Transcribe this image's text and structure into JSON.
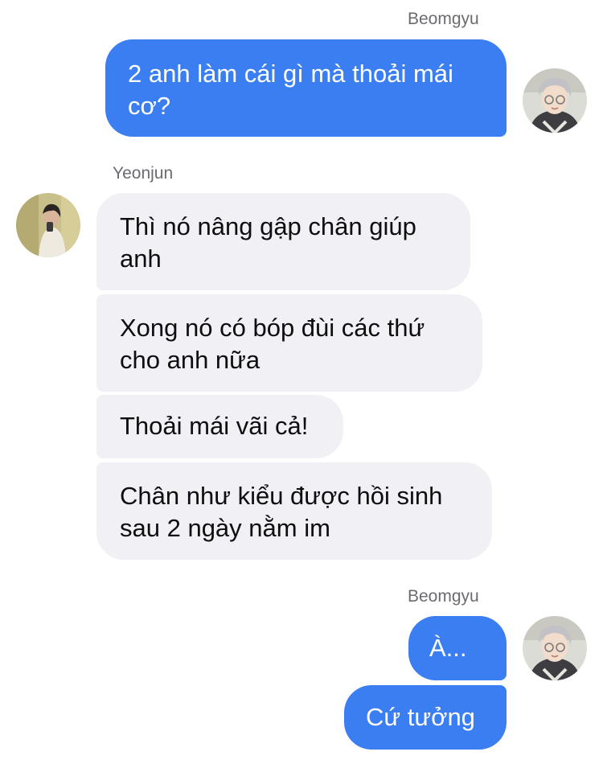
{
  "conversation": {
    "groups": [
      {
        "sender": "Beomgyu",
        "direction": "outgoing",
        "avatar_icon": "beomgyu-avatar",
        "messages": [
          "2 anh làm cái gì mà thoải mái cơ?"
        ]
      },
      {
        "sender": "Yeonjun",
        "direction": "incoming",
        "avatar_icon": "yeonjun-avatar",
        "messages": [
          "Thì nó nâng gập chân giúp anh",
          "Xong nó có bóp đùi các thứ cho anh nữa",
          "Thoải mái vãi cả!",
          "Chân như kiểu được hồi sinh sau 2 ngày nằm im"
        ]
      },
      {
        "sender": "Beomgyu",
        "direction": "outgoing",
        "avatar_icon": "beomgyu-avatar",
        "messages": [
          "À...",
          "Cứ tưởng"
        ]
      }
    ]
  },
  "colors": {
    "outgoing_bubble": "#3a7ef2",
    "incoming_bubble": "#f0f0f5",
    "sender_name": "#6b6b70"
  }
}
